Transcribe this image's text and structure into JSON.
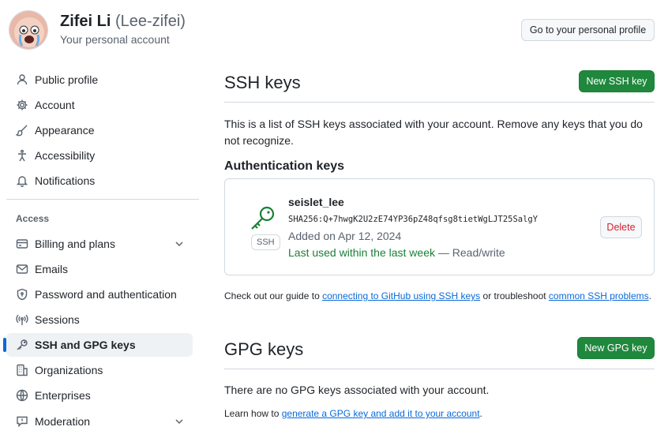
{
  "account": {
    "display_name": "Zifei Li",
    "login": "(Lee-zifei)",
    "subtitle": "Your personal account",
    "profile_button": "Go to your personal profile"
  },
  "sidebar": {
    "items": [
      {
        "label": "Public profile",
        "icon": "person-icon"
      },
      {
        "label": "Account",
        "icon": "gear-icon"
      },
      {
        "label": "Appearance",
        "icon": "paintbrush-icon"
      },
      {
        "label": "Accessibility",
        "icon": "accessibility-icon"
      },
      {
        "label": "Notifications",
        "icon": "bell-icon"
      }
    ],
    "section_label": "Access",
    "access_items": [
      {
        "label": "Billing and plans",
        "icon": "credit-card-icon",
        "expandable": true
      },
      {
        "label": "Emails",
        "icon": "mail-icon"
      },
      {
        "label": "Password and authentication",
        "icon": "shield-lock-icon"
      },
      {
        "label": "Sessions",
        "icon": "broadcast-icon"
      },
      {
        "label": "SSH and GPG keys",
        "icon": "key-icon",
        "active": true
      },
      {
        "label": "Organizations",
        "icon": "organization-icon"
      },
      {
        "label": "Enterprises",
        "icon": "globe-icon"
      },
      {
        "label": "Moderation",
        "icon": "report-icon",
        "expandable": true
      }
    ]
  },
  "ssh": {
    "title": "SSH keys",
    "new_button": "New SSH key",
    "description": "This is a list of SSH keys associated with your account. Remove any keys that you do not recognize.",
    "auth_heading": "Authentication keys",
    "key": {
      "title": "seislet_lee",
      "fingerprint": "SHA256:Q+7hwgK2U2zE74YP36pZ48qfsg8tietWgLJT25SalgY",
      "added": "Added on Apr 12, 2024",
      "last_used": "Last used within the last week",
      "access": " — Read/write",
      "badge": "SSH",
      "delete_button": "Delete"
    },
    "guide_prefix": "Check out our guide to ",
    "guide_link1": "connecting to GitHub using SSH keys",
    "guide_middle": " or troubleshoot ",
    "guide_link2": "common SSH problems",
    "guide_suffix": "."
  },
  "gpg": {
    "title": "GPG keys",
    "new_button": "New GPG key",
    "empty_text": "There are no GPG keys associated with your account.",
    "learn_prefix": "Learn how to ",
    "learn_link": "generate a GPG key and add it to your account",
    "learn_suffix": "."
  },
  "colors": {
    "accent": "#0969da",
    "primary_button": "#1f883d",
    "success": "#1a7f37",
    "danger": "#d1242f"
  }
}
